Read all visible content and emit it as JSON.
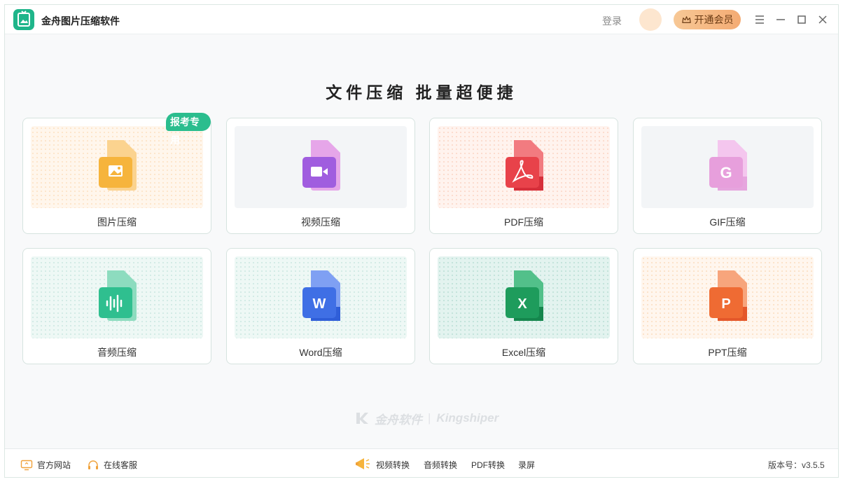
{
  "app": {
    "title": "金舟图片压缩软件",
    "accent_color": "#1fb58a"
  },
  "titlebar": {
    "login_label": "登录",
    "vip_label": "开通会员",
    "vip_icon": "crown-icon",
    "controls": [
      "menu-icon",
      "minimize-icon",
      "maximize-icon",
      "close-icon"
    ]
  },
  "main": {
    "headline": "文件压缩  批量超便捷",
    "cards": [
      {
        "label": "图片压缩",
        "badge": "报考专用",
        "icon": "image-file-icon",
        "color": "#f6b43c"
      },
      {
        "label": "视频压缩",
        "icon": "video-file-icon",
        "color": "#a05ddf"
      },
      {
        "label": "PDF压缩",
        "icon": "pdf-file-icon",
        "color": "#e8424a"
      },
      {
        "label": "GIF压缩",
        "icon": "gif-file-icon",
        "color": "#e79fdc"
      },
      {
        "label": "音频压缩",
        "icon": "audio-file-icon",
        "color": "#2fbf8f"
      },
      {
        "label": "Word压缩",
        "icon": "word-file-icon",
        "color": "#3f6fe5"
      },
      {
        "label": "Excel压缩",
        "icon": "excel-file-icon",
        "color": "#1e9c5c"
      },
      {
        "label": "PPT压缩",
        "icon": "ppt-file-icon",
        "color": "#ef6b33"
      }
    ]
  },
  "brand": {
    "name_cn": "金舟软件",
    "name_en": "Kingshiper"
  },
  "footer": {
    "official_site": "官方网站",
    "online_service": "在线客服",
    "tools": [
      "视频转换",
      "音频转换",
      "PDF转换",
      "录屏"
    ],
    "version": "版本号：v3.5.5"
  }
}
